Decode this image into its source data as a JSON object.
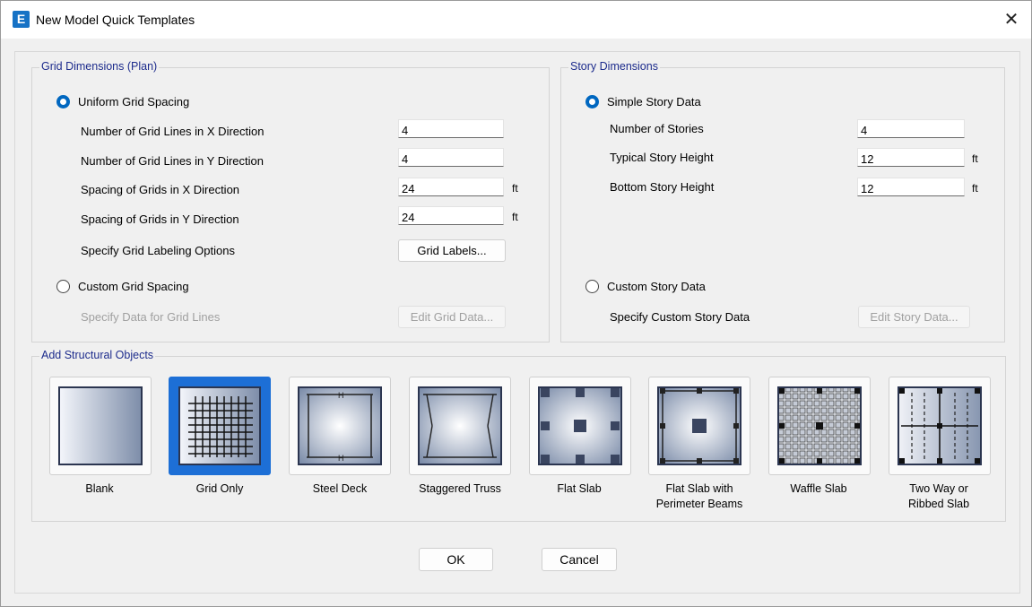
{
  "window": {
    "title": "New Model Quick Templates",
    "app_icon": "E",
    "close_glyph": "✕"
  },
  "grid": {
    "title": "Grid Dimensions (Plan)",
    "uniform_label": "Uniform Grid Spacing",
    "num_x_label": "Number of Grid Lines in X Direction",
    "num_x_value": "4",
    "num_y_label": "Number of Grid Lines in Y Direction",
    "num_y_value": "4",
    "spacing_x_label": "Spacing of Grids in X Direction",
    "spacing_x_value": "24",
    "spacing_x_unit": "ft",
    "spacing_y_label": "Spacing of Grids in Y Direction",
    "spacing_y_value": "24",
    "spacing_y_unit": "ft",
    "labeling_label": "Specify Grid Labeling Options",
    "labels_button": "Grid Labels...",
    "custom_label": "Custom Grid Spacing",
    "custom_data_label": "Specify Data for Grid Lines",
    "edit_button": "Edit Grid Data..."
  },
  "story": {
    "title": "Story Dimensions",
    "simple_label": "Simple Story Data",
    "num_label": "Number of Stories",
    "num_value": "4",
    "typical_label": "Typical Story Height",
    "typical_value": "12",
    "typical_unit": "ft",
    "bottom_label": "Bottom Story Height",
    "bottom_value": "12",
    "bottom_unit": "ft",
    "custom_label": "Custom Story Data",
    "custom_data_label": "Specify Custom Story Data",
    "edit_button": "Edit Story Data..."
  },
  "objects": {
    "title": "Add Structural Objects",
    "selected": "Grid Only",
    "templates": [
      {
        "label1": "Blank",
        "label2": ""
      },
      {
        "label1": "Grid Only",
        "label2": ""
      },
      {
        "label1": "Steel Deck",
        "label2": ""
      },
      {
        "label1": "Staggered Truss",
        "label2": ""
      },
      {
        "label1": "Flat Slab",
        "label2": ""
      },
      {
        "label1": "Flat Slab with",
        "label2": "Perimeter Beams"
      },
      {
        "label1": "Waffle Slab",
        "label2": ""
      },
      {
        "label1": "Two Way or",
        "label2": "Ribbed Slab"
      }
    ]
  },
  "buttons": {
    "ok": "OK",
    "cancel": "Cancel"
  },
  "colors": {
    "accent": "#0067c0",
    "selected_tile": "#1d6fd6",
    "group_title": "#1c2b8c"
  }
}
